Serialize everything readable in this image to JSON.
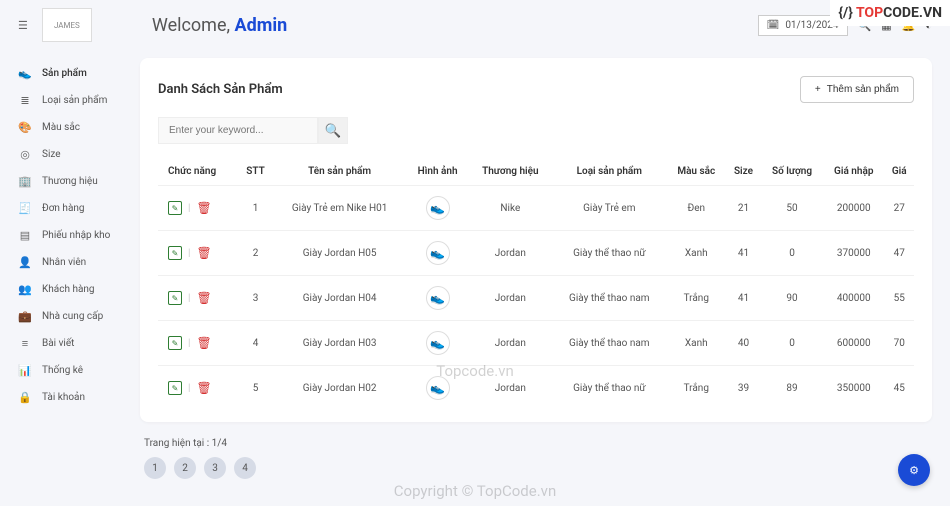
{
  "header": {
    "logo_text": "JAMES",
    "welcome_prefix": "Welcome, ",
    "welcome_name": "Admin",
    "date": "01/13/2024",
    "topcode_prefix": "{/} ",
    "topcode_top": "TOP",
    "topcode_code": "CODE",
    "topcode_suffix": ".VN"
  },
  "sidebar": {
    "items": [
      {
        "icon": "👟",
        "label": "Sản phẩm"
      },
      {
        "icon": "≣",
        "label": "Loại sản phẩm"
      },
      {
        "icon": "🎨",
        "label": "Màu sắc"
      },
      {
        "icon": "◎",
        "label": "Size"
      },
      {
        "icon": "🏢",
        "label": "Thương hiệu"
      },
      {
        "icon": "🧾",
        "label": "Đơn hàng"
      },
      {
        "icon": "▤",
        "label": "Phiếu nhập kho"
      },
      {
        "icon": "👤",
        "label": "Nhân viên"
      },
      {
        "icon": "👥",
        "label": "Khách hàng"
      },
      {
        "icon": "💼",
        "label": "Nhà cung cấp"
      },
      {
        "icon": "≡",
        "label": "Bài viết"
      },
      {
        "icon": "📊",
        "label": "Thống kê"
      },
      {
        "icon": "🔒",
        "label": "Tài khoản"
      }
    ]
  },
  "card": {
    "title": "Danh Sách Sản Phẩm",
    "add_label": "Thêm sản phẩm",
    "search_placeholder": "Enter your keyword..."
  },
  "table": {
    "headers": [
      "Chức năng",
      "STT",
      "Tên sản phẩm",
      "Hình ảnh",
      "Thương hiệu",
      "Loại sản phẩm",
      "Màu sắc",
      "Size",
      "Số lượng",
      "Giá nhập",
      "Giá"
    ],
    "rows": [
      {
        "stt": "1",
        "name": "Giày Trẻ em Nike H01",
        "brand": "Nike",
        "type": "Giày Trẻ em",
        "color": "Đen",
        "size": "21",
        "qty": "50",
        "price_in": "200000",
        "price": "27"
      },
      {
        "stt": "2",
        "name": "Giày Jordan H05",
        "brand": "Jordan",
        "type": "Giày thể thao nữ",
        "color": "Xanh",
        "size": "41",
        "qty": "0",
        "price_in": "370000",
        "price": "47"
      },
      {
        "stt": "3",
        "name": "Giày Jordan H04",
        "brand": "Jordan",
        "type": "Giày thể thao nam",
        "color": "Trắng",
        "size": "41",
        "qty": "90",
        "price_in": "400000",
        "price": "55"
      },
      {
        "stt": "4",
        "name": "Giày Jordan H03",
        "brand": "Jordan",
        "type": "Giày thể thao nam",
        "color": "Xanh",
        "size": "40",
        "qty": "0",
        "price_in": "600000",
        "price": "70"
      },
      {
        "stt": "5",
        "name": "Giày Jordan H02",
        "brand": "Jordan",
        "type": "Giày thể thao nữ",
        "color": "Trắng",
        "size": "39",
        "qty": "89",
        "price_in": "350000",
        "price": "45"
      }
    ]
  },
  "pagination": {
    "label": "Trang hiện tại : 1/4",
    "pages": [
      "1",
      "2",
      "3",
      "4"
    ]
  },
  "watermarks": {
    "center": "Topcode.vn",
    "bottom": "Copyright © TopCode.vn"
  }
}
